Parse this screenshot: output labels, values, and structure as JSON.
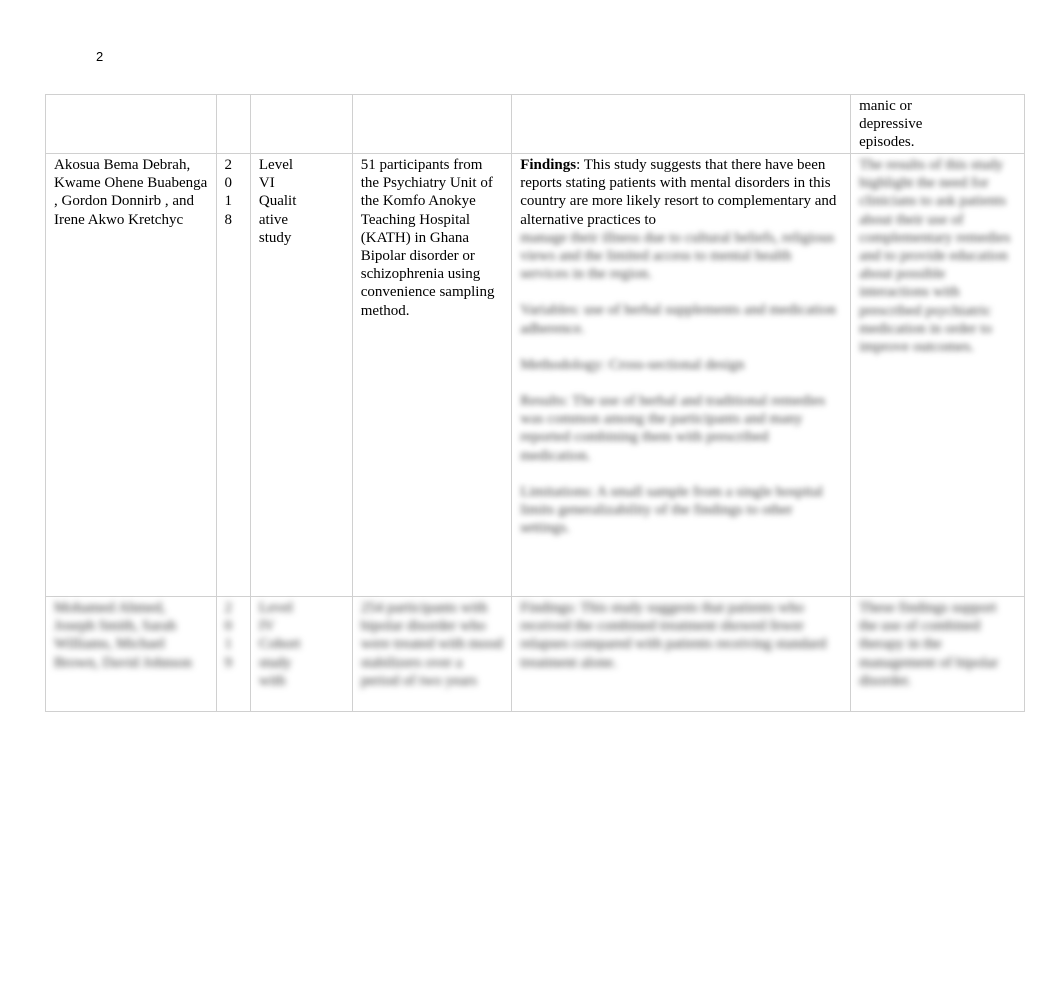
{
  "page": {
    "number": "2"
  },
  "rows": [
    {
      "authors": "",
      "year": "",
      "level": "",
      "sample": "",
      "findings_label": "",
      "findings_text": "",
      "notes": "manic or\ndepressive\nepisodes."
    },
    {
      "authors": "Akosua Bema Debrah, Kwame Ohene Buabenga , Gordon Donnirb , and Irene Akwo Kretchyc",
      "year": "2\n0\n1\n8",
      "level": "Level\nVI\nQualit\native\nstudy",
      "sample": "51 participants from the Psychiatry Unit of the Komfo Anokye Teaching Hospital (KATH) in Ghana\n Bipolar disorder or schizophrenia using convenience sampling method.",
      "findings_label": "Findings",
      "findings_text": ": This study suggests that there have been reports stating patients with mental disorders in this country are more likely resort to complementary and alternative practices to",
      "findings_blurred": [
        "manage their illness due to cultural beliefs, religious views and the limited access to mental health services in the region.",
        "Variables: use of herbal supplements and medication adherence.",
        "Methodology: Cross-sectional design",
        "Results: The use of herbal and traditional remedies was common among the participants and many reported combining them with prescribed medication.",
        "Limitations: A small sample from a single hospital limits generalizability of the findings to other settings."
      ],
      "notes_blurred": "The results of this study highlight the need for clinicians to ask patients about their use of complementary remedies and to provide education about possible interactions with prescribed psychiatric medication in order to improve outcomes."
    },
    {
      "authors_blurred": "Mohamed Ahmed, Joseph Smith, Sarah Williams, Michael Brown, David Johnson",
      "year_blurred": "2\n0\n1\n9",
      "level_blurred": "Level\nIV\nCohort\nstudy\nwith",
      "sample_blurred": "254 participants with bipolar disorder who were treated with mood stabilizers over a period of two years",
      "findings_blurred": "Findings: This study suggests that patients who received the combined treatment showed fewer relapses compared with patients receiving standard treatment alone.",
      "notes_blurred": "These findings support the use of combined therapy in the management of bipolar disorder."
    }
  ]
}
